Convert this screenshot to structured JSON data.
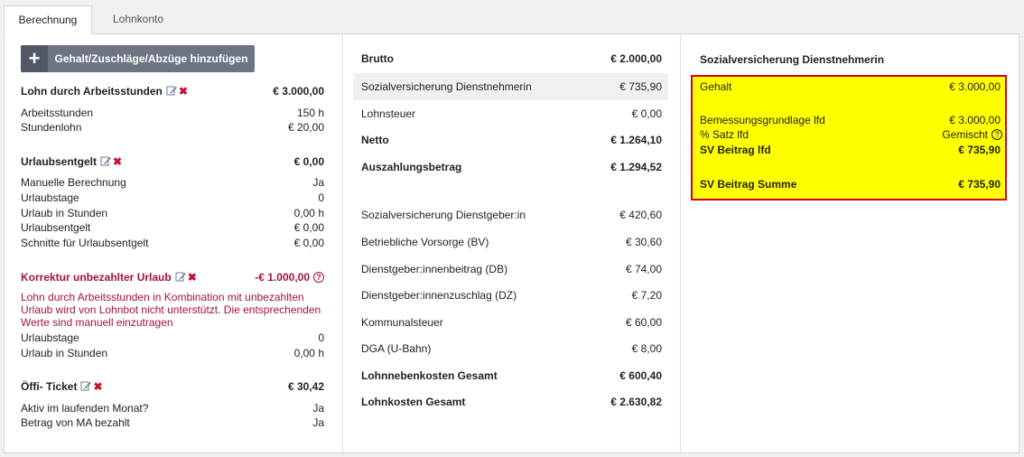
{
  "tabs": [
    {
      "label": "Berechnung",
      "active": true
    },
    {
      "label": "Lohnkonto",
      "active": false
    }
  ],
  "left": {
    "add_button_label": "Gehalt/Zuschläge/Abzüge hinzufügen",
    "sections": {
      "lohn": {
        "title": "Lohn durch Arbeitsstunden",
        "value": "€ 3.000,00",
        "rows": [
          {
            "label": "Arbeitsstunden",
            "value": "150 h"
          },
          {
            "label": "Stundenlohn",
            "value": "€ 20,00"
          }
        ]
      },
      "urlaub": {
        "title": "Urlaubsentgelt",
        "value": "€ 0,00",
        "rows": [
          {
            "label": "Manuelle Berechnung",
            "value": "Ja"
          },
          {
            "label": "Urlaubstage",
            "value": "0"
          },
          {
            "label": "Urlaub in Stunden",
            "value": "0,00 h"
          },
          {
            "label": "Urlaubsentgelt",
            "value": "€ 0,00"
          },
          {
            "label": "Schnitte für Urlaubsentgelt",
            "value": "€ 0,00"
          }
        ]
      },
      "korrektur": {
        "title": "Korrektur unbezahlter Urlaub",
        "value": "-€ 1.000,00",
        "message": "Lohn durch Arbeitsstunden in Kombination mit unbezahlten Urlaub wird von Lohnbot nicht unterstützt. Die entsprechenden Werte sind manuell einzutragen",
        "rows": [
          {
            "label": "Urlaubstage",
            "value": "0"
          },
          {
            "label": "Urlaub in Stunden",
            "value": "0,00 h"
          }
        ]
      },
      "ticket": {
        "title": "Öffi- Ticket",
        "value": "€ 30,42",
        "rows": [
          {
            "label": "Aktiv im laufenden Monat?",
            "value": "Ja"
          },
          {
            "label": "Betrag von MA bezahlt",
            "value": "Ja"
          }
        ]
      }
    }
  },
  "middle": {
    "rows": [
      {
        "label": "Brutto",
        "value": "€ 2.000,00",
        "bold": true
      },
      {
        "label": "Sozialversicherung Dienstnehmerin",
        "value": "€ 735,90",
        "bold": false,
        "highlighted": true
      },
      {
        "label": "Lohnsteuer",
        "value": "€ 0,00",
        "bold": false
      },
      {
        "label": "Netto",
        "value": "€ 1.264,10",
        "bold": true
      },
      {
        "label": "Auszahlungsbetrag",
        "value": "€ 1.294,52",
        "bold": true
      },
      {
        "label": "Sozialversicherung Dienstgeber:in",
        "value": "€ 420,60",
        "bold": false
      },
      {
        "label": "Betriebliche Vorsorge (BV)",
        "value": "€ 30,60",
        "bold": false
      },
      {
        "label": "Dienstgeber:innenbeitrag (DB)",
        "value": "€ 74,00",
        "bold": false
      },
      {
        "label": "Dienstgeber:innenzuschlag (DZ)",
        "value": "€ 7,20",
        "bold": false
      },
      {
        "label": "Kommunalsteuer",
        "value": "€ 60,00",
        "bold": false
      },
      {
        "label": "DGA (U-Bahn)",
        "value": "€ 8,00",
        "bold": false
      },
      {
        "label": "Lohnnebenkosten Gesamt",
        "value": "€ 600,40",
        "bold": true
      },
      {
        "label": "Lohnkosten Gesamt",
        "value": "€ 2.630,82",
        "bold": true
      }
    ]
  },
  "right": {
    "title": "Sozialversicherung Dienstnehmerin",
    "rows": [
      {
        "label": "Gehalt",
        "value": "€ 3.000,00",
        "bold": false
      },
      {
        "label": "Bemessungsgrundlage lfd",
        "value": "€ 3.000,00",
        "bold": false
      },
      {
        "label": "% Satz lfd",
        "value": "Gemischt",
        "bold": false,
        "help": true
      },
      {
        "label": "SV Beitrag lfd",
        "value": "€ 735,90",
        "bold": true
      },
      {
        "label": "SV Beitrag Summe",
        "value": "€ 735,90",
        "bold": true
      }
    ],
    "box_color": "#ffff00",
    "box_border_color": "#d4002a"
  },
  "colors": {
    "accent_red": "#a4123f",
    "button_bg": "#6d7583"
  },
  "icons": {
    "edit": "edit-icon",
    "delete": "delete-icon",
    "help": "help-icon",
    "plus": "plus-icon"
  }
}
